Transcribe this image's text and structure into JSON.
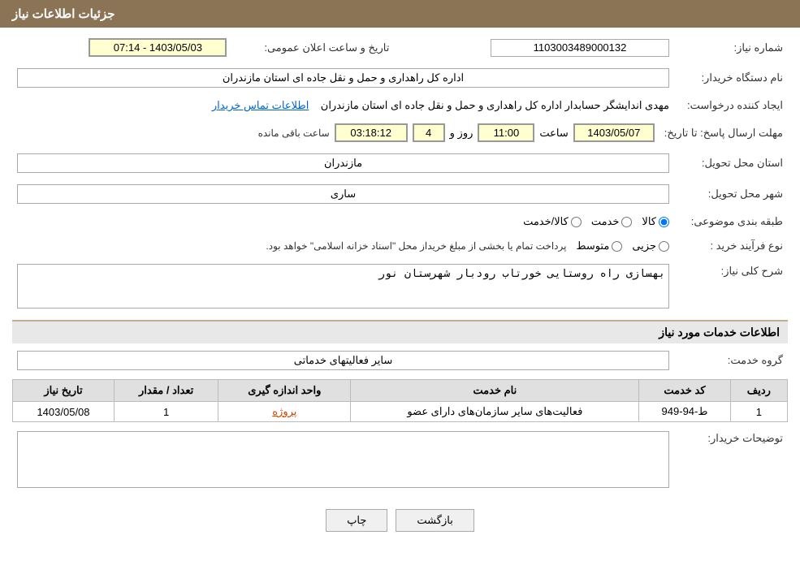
{
  "header": {
    "title": "جزئیات اطلاعات نیاز"
  },
  "fields": {
    "شماره_نیاز_label": "شماره نیاز:",
    "شماره_نیاز_value": "1103003489000132",
    "تاریخ_label": "تاریخ و ساعت اعلان عمومی:",
    "تاریخ_value": "1403/05/03 - 07:14",
    "نام_دستگاه_label": "نام دستگاه خریدار:",
    "نام_دستگاه_value": "اداره کل راهداری و حمل و نقل جاده ای استان مازندران",
    "ایجاد_کننده_label": "ایجاد کننده درخواست:",
    "ایجاد_کننده_value": "مهدی اندایشگر حسابدار اداره کل راهداری و حمل و نقل جاده ای استان مازندران",
    "اطلاعات_تماس": "اطلاعات تماس خریدار",
    "مهلت_label": "مهلت ارسال پاسخ: تا تاریخ:",
    "مهلت_date": "1403/05/07",
    "مهلت_ساعت_label": "ساعت",
    "مهلت_ساعت": "11:00",
    "مهلت_روز_label": "روز و",
    "مهلت_روز": "4",
    "مهلت_باقی_label": "ساعت باقی مانده",
    "مهلت_باقی": "03:18:12",
    "استان_label": "استان محل تحویل:",
    "استان_value": "مازندران",
    "شهر_label": "شهر محل تحویل:",
    "شهر_value": "ساری",
    "طبقه_label": "طبقه بندی موضوعی:",
    "طبقه_options": [
      "کالا",
      "خدمت",
      "کالا/خدمت"
    ],
    "طبقه_selected": "کالا",
    "نوع_فرآیند_label": "نوع فرآیند خرید :",
    "نوع_فرآیند_options": [
      "جزیی",
      "متوسط"
    ],
    "نوع_فرآیند_text": "پرداخت تمام یا بخشی از مبلغ خریداز محل \"اسناد خزانه اسلامی\" خواهد بود.",
    "شرح_نیاز_label": "شرح کلی نیاز:",
    "شرح_نیاز_value": "بهسازی راه روستایی خورتاب رودبار شهرستان نور",
    "خدمات_title": "اطلاعات خدمات مورد نیاز",
    "گروه_خدمت_label": "گروه خدمت:",
    "گروه_خدمت_value": "سایر فعالیتهای خدماتی",
    "table": {
      "headers": [
        "ردیف",
        "کد خدمت",
        "نام خدمت",
        "واحد اندازه گیری",
        "تعداد / مقدار",
        "تاریخ نیاز"
      ],
      "rows": [
        {
          "ردیف": "1",
          "کد_خدمت": "ط-94-949",
          "نام_خدمت": "فعالیت‌های سایر سازمان‌های دارای عضو",
          "واحد": "پروژه",
          "تعداد": "1",
          "تاریخ": "1403/05/08"
        }
      ]
    },
    "توضیحات_label": "توضیحات خریدار:",
    "توضیحات_value": ""
  },
  "buttons": {
    "چاپ": "چاپ",
    "بازگشت": "بازگشت"
  }
}
